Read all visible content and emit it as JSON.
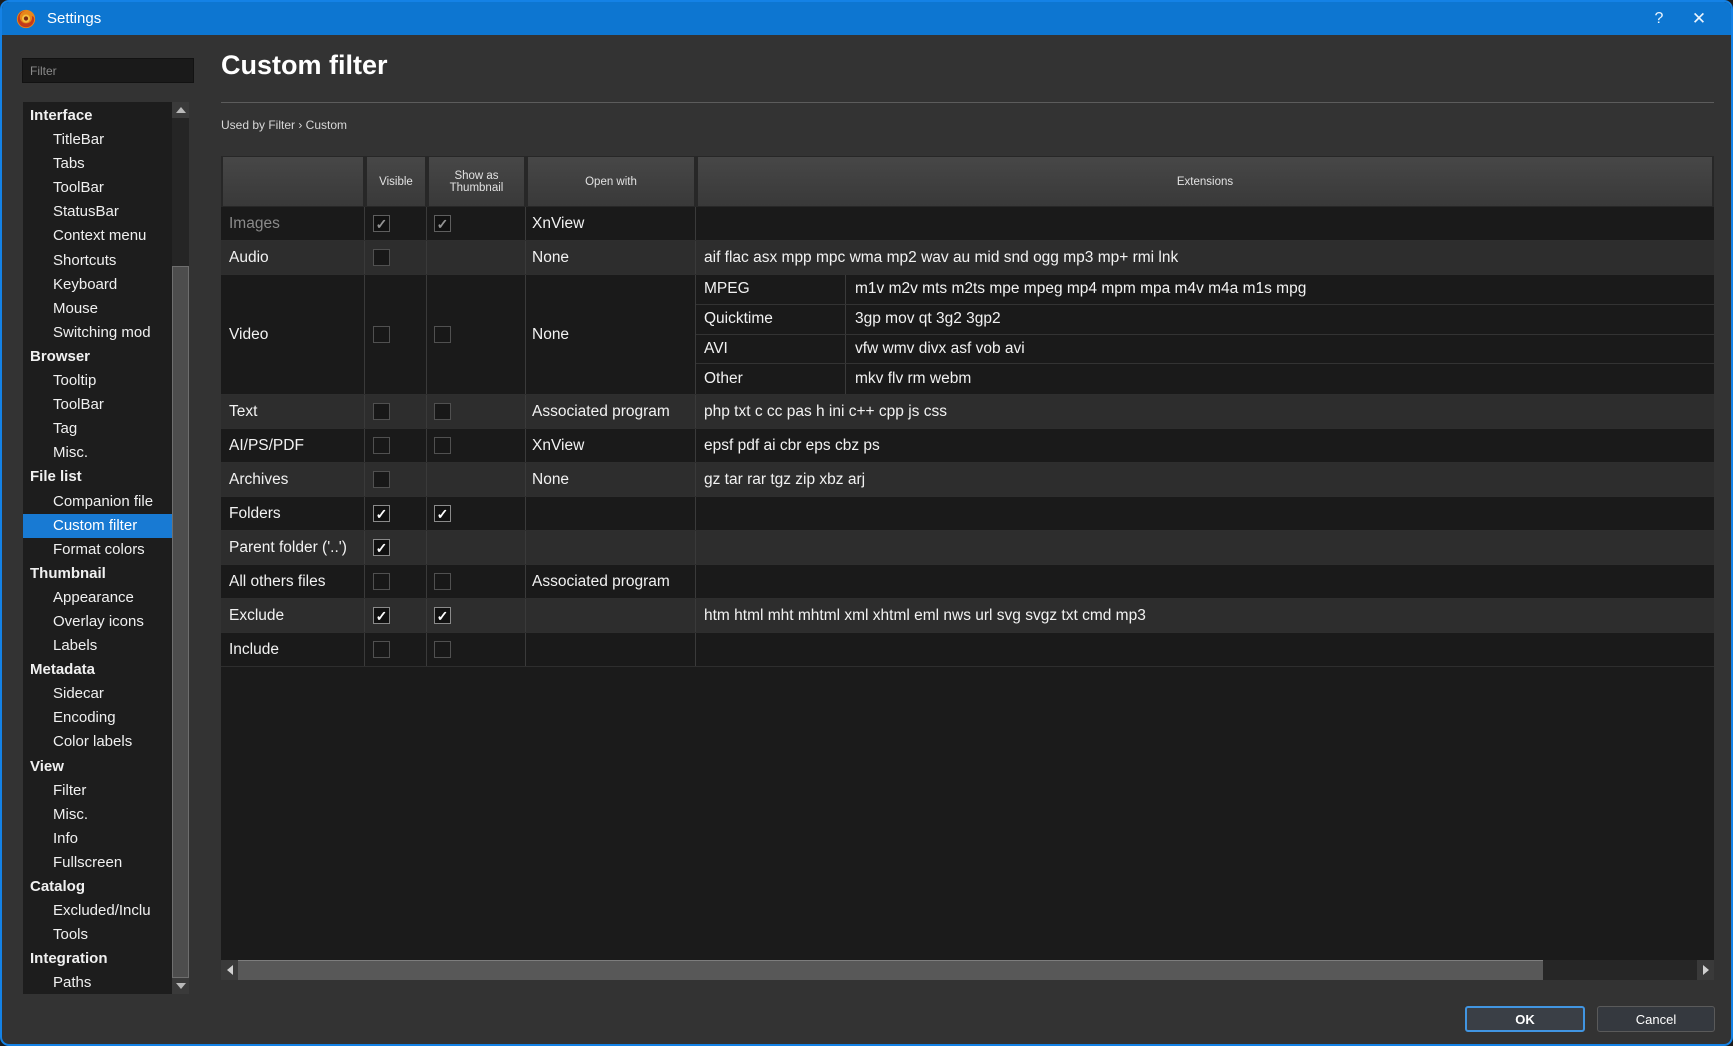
{
  "window": {
    "title": "Settings",
    "help_label": "?",
    "close_label": "✕"
  },
  "colors": {
    "titlebar_blue": "#0d76d1",
    "selection_blue": "#187ad3",
    "window_bg": "#333333",
    "row_dark": "#1a1a1a",
    "row_light": "#2d2d2d",
    "ok_border_blue": "#4195e1"
  },
  "sidebar": {
    "filter_placeholder": "Filter",
    "tree": [
      {
        "label": "Interface",
        "group": true
      },
      {
        "label": "TitleBar"
      },
      {
        "label": "Tabs"
      },
      {
        "label": "ToolBar"
      },
      {
        "label": "StatusBar"
      },
      {
        "label": "Context menu"
      },
      {
        "label": "Shortcuts"
      },
      {
        "label": "Keyboard"
      },
      {
        "label": "Mouse"
      },
      {
        "label": "Switching mod"
      },
      {
        "label": "Browser",
        "group": true
      },
      {
        "label": "Tooltip"
      },
      {
        "label": "ToolBar"
      },
      {
        "label": "Tag"
      },
      {
        "label": "Misc."
      },
      {
        "label": "File list",
        "group": true
      },
      {
        "label": "Companion file"
      },
      {
        "label": "Custom filter",
        "selected": true
      },
      {
        "label": "Format colors"
      },
      {
        "label": "Thumbnail",
        "group": true
      },
      {
        "label": "Appearance"
      },
      {
        "label": "Overlay icons"
      },
      {
        "label": "Labels"
      },
      {
        "label": "Metadata",
        "group": true
      },
      {
        "label": "Sidecar"
      },
      {
        "label": "Encoding"
      },
      {
        "label": "Color labels"
      },
      {
        "label": "View",
        "group": true
      },
      {
        "label": "Filter"
      },
      {
        "label": "Misc."
      },
      {
        "label": "Info"
      },
      {
        "label": "Fullscreen"
      },
      {
        "label": "Catalog",
        "group": true
      },
      {
        "label": "Excluded/Inclu"
      },
      {
        "label": "Tools"
      },
      {
        "label": "Integration",
        "group": true
      },
      {
        "label": "Paths"
      }
    ]
  },
  "main": {
    "title": "Custom filter",
    "used_by": "Used by Filter › Custom",
    "table": {
      "check_glyph": "✓",
      "columns": [
        "",
        "Visible",
        "Show as Thumbnail",
        "Open with",
        "Extensions"
      ],
      "rows": [
        {
          "label": "Images",
          "dimmed": true,
          "visible": "checked",
          "thumbnail": "checked",
          "open_with": "XnView",
          "extensions": ""
        },
        {
          "label": "Audio",
          "visible": "unchecked",
          "thumbnail": "none",
          "open_with": "None",
          "extensions": "aif flac asx mpp mpc wma mp2 wav au mid snd ogg mp3 mp+ rmi lnk"
        },
        {
          "label": "Video",
          "visible": "unchecked",
          "thumbnail": "unchecked",
          "open_with": "None",
          "formats": [
            {
              "name": "MPEG",
              "extensions": "m1v m2v mts m2ts mpe mpeg mp4 mpm mpa m4v m4a m1s mpg"
            },
            {
              "name": "Quicktime",
              "extensions": "3gp mov qt 3g2 3gp2"
            },
            {
              "name": "AVI",
              "extensions": "vfw wmv divx asf vob avi"
            },
            {
              "name": "Other",
              "extensions": "mkv flv rm webm"
            }
          ]
        },
        {
          "label": "Text",
          "visible": "unchecked",
          "thumbnail": "unchecked",
          "open_with": "Associated program",
          "extensions": "php txt c cc pas h ini c++ cpp js css"
        },
        {
          "label": "AI/PS/PDF",
          "visible": "unchecked",
          "thumbnail": "unchecked",
          "open_with": "XnView",
          "extensions": "epsf pdf ai cbr eps cbz ps"
        },
        {
          "label": "Archives",
          "visible": "unchecked",
          "thumbnail": "none",
          "open_with": "None",
          "extensions": "gz tar rar tgz zip xbz arj"
        },
        {
          "label": "Folders",
          "visible": "checked",
          "thumbnail": "checked",
          "open_with": "",
          "extensions": ""
        },
        {
          "label": "Parent folder ('..')",
          "visible": "checked",
          "thumbnail": "none",
          "open_with": "",
          "extensions": ""
        },
        {
          "label": "All others files",
          "visible": "unchecked",
          "thumbnail": "unchecked",
          "open_with": "Associated program",
          "extensions": ""
        },
        {
          "label": "Exclude",
          "visible": "checked",
          "thumbnail": "checked",
          "open_with": "",
          "extensions": "htm html mht mhtml xml xhtml eml nws url svg svgz txt cmd mp3"
        },
        {
          "label": "Include",
          "visible": "unchecked",
          "thumbnail": "unchecked",
          "open_with": "",
          "extensions": ""
        }
      ]
    }
  },
  "footer": {
    "ok_label": "OK",
    "cancel_label": "Cancel"
  }
}
